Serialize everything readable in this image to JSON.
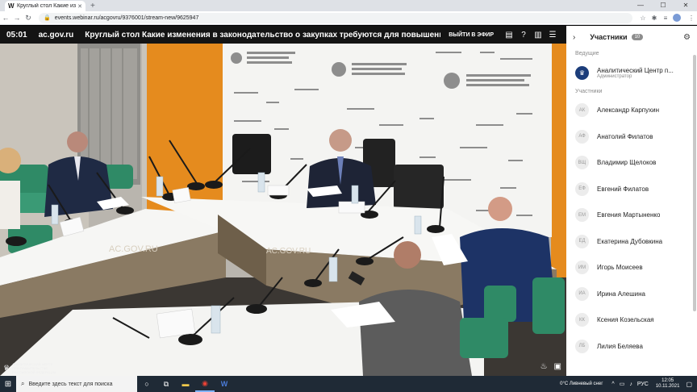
{
  "browser": {
    "tab_title": "Круглый стол Какие изменен...",
    "tab_favicon": "W",
    "url": "events.webinar.ru/acgovru/9376001/stream-new/9625947"
  },
  "stream": {
    "time": "05:01",
    "site": "ac.gov.ru",
    "title": "Круглый стол Какие изменения в законодательство о закупках требуются для повышения возможн...",
    "leave_label": "ВЫЙТИ В ЭФИР"
  },
  "video": {
    "backdrop_brand": "АНАЛИТИЧЕСКИЙ ЦЕНТР ПРИ ПРАВИТЕЛЬСТВЕ РОССИЙСКОЙ ФЕДЕРАЦИИ",
    "table_label": "AC.GOV.RU",
    "logo_lines": [
      "АНАЛИТИЧЕСКИЙ ЦЕНТР",
      "ПРИ ПРАВИТЕЛЬСТВЕ",
      "РОССИЙСКОЙ ФЕДЕРАЦИИ"
    ]
  },
  "sidebar": {
    "title": "Участники",
    "count": "10",
    "hosts_label": "Ведущие",
    "host": {
      "initials": "",
      "name": "Аналитический Центр п...",
      "role": "Администратор"
    },
    "participants_label": "Участники",
    "participants": [
      {
        "initials": "АК",
        "name": "Александр Карпухин"
      },
      {
        "initials": "АФ",
        "name": "Анатолий Филатов"
      },
      {
        "initials": "ВЩ",
        "name": "Владимир Щелоков"
      },
      {
        "initials": "ЕФ",
        "name": "Евгений Филатов"
      },
      {
        "initials": "ЕМ",
        "name": "Евгения Мартыненко"
      },
      {
        "initials": "ЕД",
        "name": "Екатерина Дубовкина"
      },
      {
        "initials": "ИМ",
        "name": "Игорь Моисеев"
      },
      {
        "initials": "ИА",
        "name": "Ирина Алешина"
      },
      {
        "initials": "КК",
        "name": "Ксения Козельская"
      },
      {
        "initials": "ЛБ",
        "name": "Лилия Беляева"
      }
    ]
  },
  "taskbar": {
    "search_placeholder": "Введите здесь текст для поиска",
    "weather": "0°C  Ливневый снег",
    "lang": "РУС",
    "time": "12:05",
    "date": "10.11.2021"
  }
}
